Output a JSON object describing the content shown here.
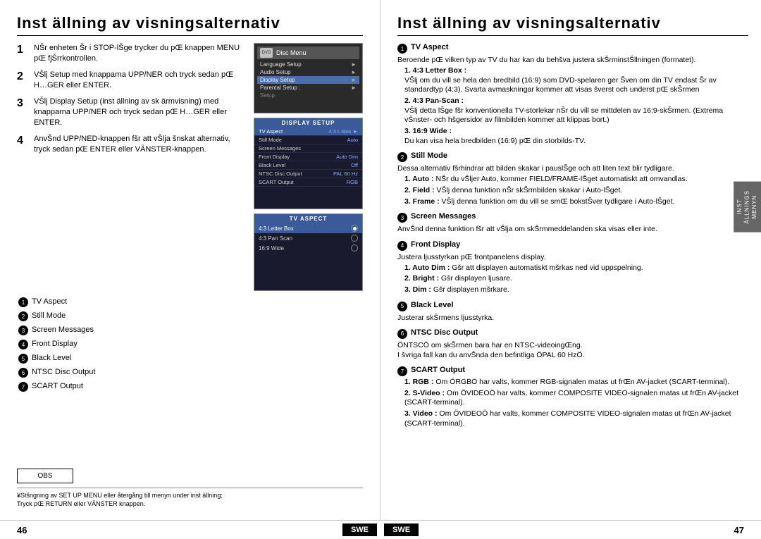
{
  "left": {
    "title": "Inst ällning av visningsalternativ",
    "title_inst": "Inst",
    "title_rest": " ällning av visningsalternativ",
    "steps": [
      {
        "num": "1",
        "text": "NŠr enheten Šr i STOP-lŠge trycker du pŒ knappen MENU pŒ fjŠrrkontrollen."
      },
      {
        "num": "2",
        "text": "VŠlj Setup med knapparna UPP/NER och tryck sedan pŒ H…GER eller ENTER."
      },
      {
        "num": "3",
        "text": "VŠlj Display Setup (inst ällning av sk ärmvisning) med knapparna UPP/NER och tryck sedan pŒ H…GER eller ENTER."
      },
      {
        "num": "4",
        "text": "AnvŠnd UPP/NED-knappen fšr att vŠlja šnskat alternativ, tryck sedan pŒ ENTER eller VÄNSTER-knappen."
      }
    ],
    "list_items": [
      {
        "num": "1",
        "label": "TV Aspect"
      },
      {
        "num": "2",
        "label": "Still Mode"
      },
      {
        "num": "3",
        "label": "Screen Messages"
      },
      {
        "num": "4",
        "label": "Front Display"
      },
      {
        "num": "5",
        "label": "Black Level"
      },
      {
        "num": "6",
        "label": "NTSC Disc Output"
      },
      {
        "num": "7",
        "label": "SCART Output"
      }
    ],
    "obs_label": "OBS",
    "footnote_line1": "¥Stšngning av SET UP MENU eller  återgång till menyn under inst  ällning;",
    "footnote_line2": "Tryck pŒ RETURN eller VÄNSTER knappen.",
    "page_num": "46",
    "lang_badge": "SWE",
    "dvd_menu": {
      "title": "Disc Menu",
      "items": [
        {
          "label": "Language Setup",
          "arrow": "►",
          "highlighted": false
        },
        {
          "label": "Audio Setup",
          "arrow": "►",
          "highlighted": false
        },
        {
          "label": "Display Setup",
          "arrow": "►",
          "highlighted": true
        },
        {
          "label": "Parental Setup :",
          "arrow": "►",
          "highlighted": false
        }
      ],
      "setup": "Setup"
    },
    "display_setup": {
      "title": "DISPLAY SETUP",
      "rows": [
        {
          "label": "TV Aspect",
          "value": "4:3 L-Box",
          "selected": true
        },
        {
          "label": "Still Mode",
          "value": "Auto",
          "selected": false
        },
        {
          "label": "Screen Messages",
          "value": "",
          "selected": false
        },
        {
          "label": "Front Display",
          "value": "Auto Dim",
          "selected": false
        },
        {
          "label": "Black Level",
          "value": "Off",
          "selected": false
        },
        {
          "label": "NTSC Disc Output",
          "value": "PAL 60 Hz",
          "selected": false
        },
        {
          "label": "SCART Output",
          "value": "RGB",
          "selected": false
        }
      ]
    },
    "tv_aspect": {
      "title": "TV ASPECT",
      "rows": [
        {
          "label": "4:3 Letter Box",
          "selected": true
        },
        {
          "label": "4:3 Pan Scan",
          "selected": false
        },
        {
          "label": "16:9 Wide",
          "selected": false
        }
      ]
    }
  },
  "right": {
    "title": "Inst  ällning av visningsalternativ",
    "title_inst": "Inst",
    "title_rest": "  ällning av visningsalternativ",
    "sections": [
      {
        "num": "1",
        "heading": "TV Aspect",
        "intro": "Beroende pŒ vilken typ av TV du har kan du behšva justera skŠrminstŠllningen (formatet).",
        "sub": [
          {
            "label": "1. 4:3 Letter Box :",
            "text": "VŠlj om du vill se hela den bredbild (16:9) som DVD-spelaren ger Šven om din TV endast Šr av standardtyp (4:3). Svarta avmaskningar kommer att visas šverst och underst pŒ skŠrmen"
          },
          {
            "label": "2. 4:3 Pan-Scan :",
            "text": "VŠlj detta lŠge fšr konventionella TV-storlekar nŠr du vill se mittdelen av 16:9-skŠrmen. (Extrema vŠnster- och hšgersidor av filmbilden kommer att klippas bort.)"
          },
          {
            "label": "3. 16:9 Wide :",
            "text": "Du kan visa hela bredbilden (16:9) pŒ din storbilds-TV."
          }
        ]
      },
      {
        "num": "2",
        "heading": "Still Mode",
        "intro": "Dessa alternativ fšrhindrar att bilden skakar i pauslŠge och att liten text blir tydligare.",
        "sub": [
          {
            "label": "1. Auto :",
            "text": "NŠr du vŠljer Auto, kommer FIELD/FRAME-lŠget automatiskt att omvandlas."
          },
          {
            "label": "2. Field :",
            "text": "VŠlj denna funktion nŠr skŠrmbilden skakar i Auto-lŠget."
          },
          {
            "label": "3. Frame :",
            "text": "VŠlj denna funktion om du vill se smŒ bokstŠver tydligare i Auto-lŠget."
          }
        ]
      },
      {
        "num": "3",
        "heading": "Screen Messages",
        "intro": "AnvŠnd denna funktion fšr att vŠlja om skŠrmmeddelanden ska visas eller inte."
      },
      {
        "num": "4",
        "heading": "Front Display",
        "intro": "Justera ljusstyrkan pŒ frontpanelens display.",
        "sub": [
          {
            "label": "1. Auto Dim :",
            "text": "Gšr att displayen automatiskt mšrkas ned vid uppspelning."
          },
          {
            "label": "2. Bright :",
            "text": "Gšr displayen ljusare."
          },
          {
            "label": "3. Dim :",
            "text": "Gšr displayen mšrkare."
          }
        ]
      },
      {
        "num": "5",
        "heading": "Black Level",
        "intro": "Justerar skŠrmens ljusstyrka."
      },
      {
        "num": "6",
        "heading": "NTSC Disc Output",
        "intro": "ÖNTSCÖ om skŠrmen bara har en NTSC-videoingŒng.",
        "sub2": "I švriga fall kan du anvŠnda den befintliga ÖPAL 60 HzÖ."
      },
      {
        "num": "7",
        "heading": "SCART Output",
        "sub": [
          {
            "label": "1. RGB :",
            "text": "Om ÖRGBÖ har valts, kommer RGB-signalen matas ut frŒn AV-jacket (SCART-terminal)."
          },
          {
            "label": "2. S-Video :",
            "text": "Om ÖVIDEOÖ har valts, kommer COMPOSITE VIDEO-signalen matas ut frŒn AV-jacket (SCART-terminal)."
          },
          {
            "label": "3. Video :",
            "text": "Om ÖVIDEOÖ har valts, kommer COMPOSITE VIDEO-signalen matas ut frŒn AV-jacket (SCART-terminal)."
          }
        ]
      }
    ],
    "page_num": "47",
    "lang_badge": "SWE",
    "side_tab": "INST\nÄLLNINGS\nMENYN"
  }
}
